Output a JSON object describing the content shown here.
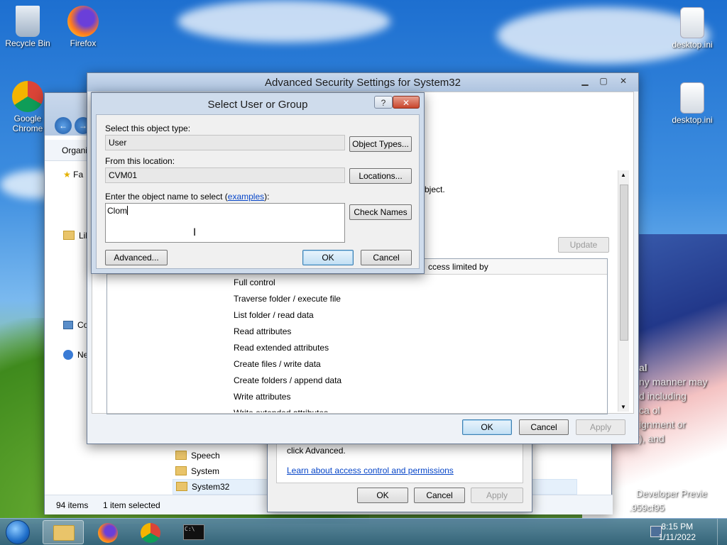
{
  "desktop": {
    "icons": [
      {
        "label": "Recycle Bin"
      },
      {
        "label": "Firefox"
      },
      {
        "label": "Google Chrome"
      },
      {
        "label": "desktop.ini"
      },
      {
        "label": "desktop.ini"
      }
    ],
    "watermark_lines": [
      "al",
      "ny manner may",
      "d including",
      "ca ol",
      "ignment or",
      "), and"
    ],
    "build_text": [
      "Developer Previe",
      ".959cf95"
    ]
  },
  "explorer": {
    "toolbar_label": "Organi",
    "nav_items": [
      "Fa",
      "Lil",
      "Co",
      "Ne"
    ],
    "files": [
      "Speech",
      "System",
      "System32"
    ],
    "status_count": "94 items",
    "status_selected": "1 item selected"
  },
  "security_props": {
    "advanced_text": "click Advanced.",
    "link": "Learn about access control and permissions",
    "ok": "OK",
    "cancel": "Cancel",
    "apply": "Apply"
  },
  "advanced_security": {
    "title": "Advanced Security Settings for System32",
    "object_text": "bject.",
    "update": "Update",
    "column_header": "ccess limited by",
    "permissions": [
      "Full control",
      "Traverse folder / execute file",
      "List folder / read data",
      "Read attributes",
      "Read extended attributes",
      "Create files / write data",
      "Create folders / append data",
      "Write attributes",
      "Write extended attributes"
    ],
    "ok": "OK",
    "cancel": "Cancel",
    "apply": "Apply"
  },
  "select_user": {
    "title": "Select User or Group",
    "help": "?",
    "close": "✕",
    "object_type_label": "Select this object type:",
    "object_type_value": "User",
    "object_types_button": "Object Types...",
    "location_label": "From this location:",
    "location_value": "CVM01",
    "locations_button": "Locations...",
    "enter_label": "Enter the object name to select (",
    "examples_link": "examples",
    "enter_label_end": "):",
    "name_value": "Clom",
    "check_names_button": "Check Names",
    "advanced_button": "Advanced...",
    "ok": "OK",
    "cancel": "Cancel"
  },
  "taskbar": {
    "time": "8:15 PM",
    "date": "1/11/2022"
  },
  "colors": {
    "link": "#0645c8",
    "accent": "#3c7fb1"
  }
}
